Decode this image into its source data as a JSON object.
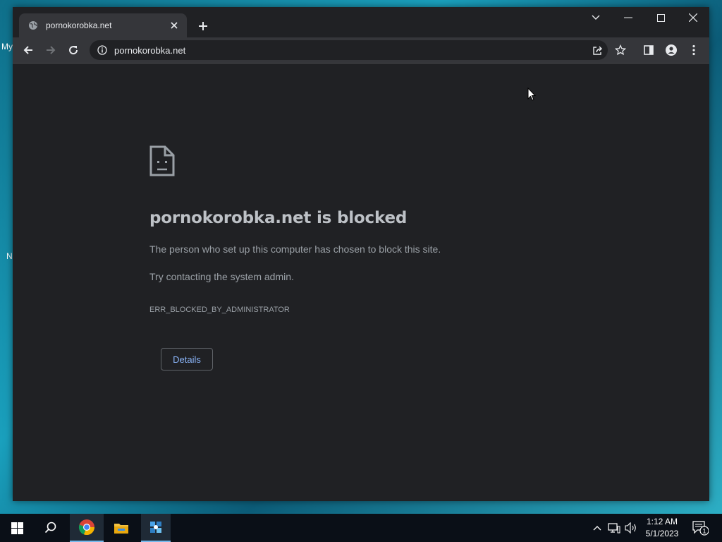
{
  "desktop": {
    "fragments": [
      "My",
      "N"
    ]
  },
  "browser": {
    "tab": {
      "title": "pornokorobka.net"
    },
    "address": {
      "url": "pornokorobka.net"
    }
  },
  "error_page": {
    "title": "pornokorobka.net is blocked",
    "message": "The person who set up this computer has chosen to block this site.",
    "suggestion": "Try contacting the system admin.",
    "code": "ERR_BLOCKED_BY_ADMINISTRATOR",
    "details_label": "Details"
  },
  "taskbar": {
    "time": "1:12 AM",
    "date": "5/1/2023",
    "notification_count": "1"
  },
  "colors": {
    "page_bg": "#202124",
    "toolbar_bg": "#35363a",
    "link_blue": "#8ab4f8",
    "title_text": "#bdc1c6",
    "body_text": "#9aa0a6"
  }
}
